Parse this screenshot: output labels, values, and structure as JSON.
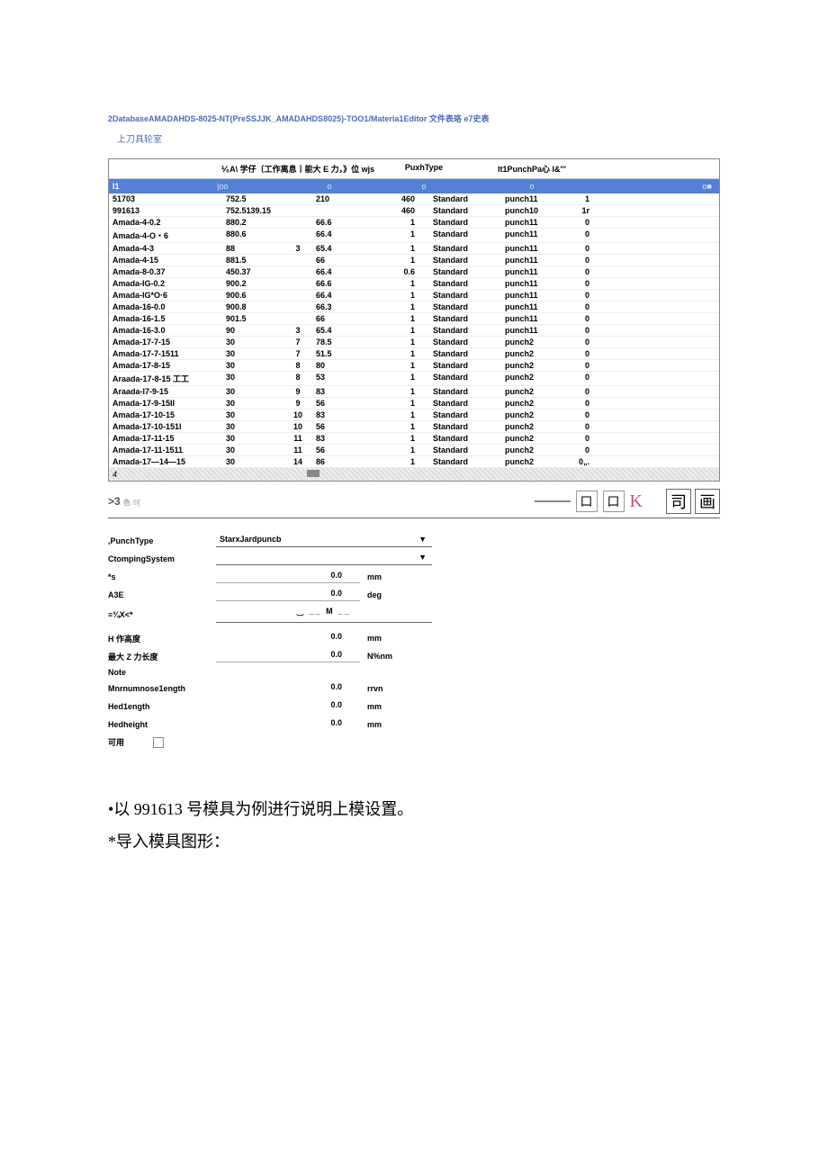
{
  "header": {
    "path": "2DatabaseAMADAHDS-8025-NT(PreSSJJK_AMADAHDS8025)-TOO1/Materia1Editor 文件表珞 e7史表",
    "subtitle": "上刀具轮室"
  },
  "table": {
    "headers": {
      "h1": "",
      "h2": "⅟₆A\\ 学仔〔工作离息丨能大 E 力，》位 wjs",
      "h3": "PuxhType",
      "h4": "It1PunchPa心 I&'''"
    },
    "filter": {
      "a": "I1",
      "b": "|oo",
      "c": "o",
      "d": "o",
      "e": "o",
      "f": "o■"
    },
    "rows": [
      {
        "name": "51703",
        "a": "752.5",
        "b": "",
        "c": "210",
        "d": "460",
        "e": "Standard",
        "f": "punch11",
        "g": "1"
      },
      {
        "name": "991613",
        "a": "752.5139.15",
        "b": "",
        "c": "",
        "d": "460",
        "e": "Standard",
        "f": "punch10",
        "g": "1r"
      },
      {
        "name": "Amada-4-0.2",
        "a": "880.2",
        "b": "",
        "c": "66.6",
        "d": "1",
        "e": "Standard",
        "f": "punch11",
        "g": "0"
      },
      {
        "name": "Amada-4-O・6",
        "a": "880.6",
        "b": "",
        "c": "66.4",
        "d": "1",
        "e": "Standard",
        "f": "punch11",
        "g": "0"
      },
      {
        "name": "Amada-4-3",
        "a": "88",
        "b": "3",
        "c": "65.4",
        "d": "1",
        "e": "Standard",
        "f": "punch11",
        "g": "0"
      },
      {
        "name": "Amada-4-15",
        "a": "881.5",
        "b": "",
        "c": "66",
        "d": "1",
        "e": "Standard",
        "f": "punch11",
        "g": "0"
      },
      {
        "name": "Amada-8-0.37",
        "a": "450.37",
        "b": "",
        "c": "66.4",
        "d": "0.6",
        "e": "Standard",
        "f": "punch11",
        "g": "0"
      },
      {
        "name": "Amada-IG-0.2",
        "a": "900.2",
        "b": "",
        "c": "66.6",
        "d": "1",
        "e": "Standard",
        "f": "punch11",
        "g": "0"
      },
      {
        "name": "Amada-IG*O·6",
        "a": "900.6",
        "b": "",
        "c": "66.4",
        "d": "1",
        "e": "Standard",
        "f": "punch11",
        "g": "0"
      },
      {
        "name": "Amada-16-0.0",
        "a": "900.8",
        "b": "",
        "c": "66.3",
        "d": "1",
        "e": "Standard",
        "f": "punch11",
        "g": "0"
      },
      {
        "name": "Amada-16-1.5",
        "a": "901.5",
        "b": "",
        "c": "66",
        "d": "1",
        "e": "Standard",
        "f": "punch11",
        "g": "0"
      },
      {
        "name": "Amada-16-3.0",
        "a": "90",
        "b": "3",
        "c": "65.4",
        "d": "1",
        "e": "Standard",
        "f": "punch11",
        "g": "0"
      },
      {
        "name": "Amada-17-7-15",
        "a": "30",
        "b": "7",
        "c": "78.5",
        "d": "1",
        "e": "Standard",
        "f": "punch2",
        "g": "0"
      },
      {
        "name": "Amada-17-7-1511",
        "a": "30",
        "b": "7",
        "c": "51.5",
        "d": "1",
        "e": "Standard",
        "f": "punch2",
        "g": "0"
      },
      {
        "name": "Amada-17-8-15",
        "a": "30",
        "b": "8",
        "c": "80",
        "d": "1",
        "e": "Standard",
        "f": "punch2",
        "g": "0"
      },
      {
        "name": "Araada-17-8-15 工工",
        "a": "30",
        "b": "8",
        "c": "53",
        "d": "1",
        "e": "Standard",
        "f": "punch2",
        "g": "0"
      },
      {
        "name": "Araada-I7-9-15",
        "a": "30",
        "b": "9",
        "c": "83",
        "d": "1",
        "e": "Standard",
        "f": "punch2",
        "g": "0"
      },
      {
        "name": "Amada-17-9-15II",
        "a": "30",
        "b": "9",
        "c": "56",
        "d": "1",
        "e": "Standard",
        "f": "punch2",
        "g": "0"
      },
      {
        "name": "Amada-17-10-15",
        "a": "30",
        "b": "10",
        "c": "83",
        "d": "1",
        "e": "Standard",
        "f": "punch2",
        "g": "0"
      },
      {
        "name": "Amada-17-10-151I",
        "a": "30",
        "b": "10",
        "c": "56",
        "d": "1",
        "e": "Standard",
        "f": "punch2",
        "g": "0"
      },
      {
        "name": "Amada-17-11-15",
        "a": "30",
        "b": "11",
        "c": "83",
        "d": "1",
        "e": "Standard",
        "f": "punch2",
        "g": "0"
      },
      {
        "name": "Amada-17-11-1511",
        "a": "30",
        "b": "11",
        "c": "56",
        "d": "1",
        "e": "Standard",
        "f": "punch2",
        "g": "0"
      },
      {
        "name": "Amada-17—14—15",
        "a": "30",
        "b": "14",
        "c": "86",
        "d": "1",
        "e": "Standard",
        "f": "punch2",
        "g": "0„."
      }
    ],
    "footer_num": "4"
  },
  "toolbar": {
    "label_prefix": ">3",
    "label_suffix": "色 ©[",
    "k": "K",
    "r1": "司",
    "r2": "画"
  },
  "form": {
    "punchtype_label": ",PunchType",
    "punchtype_value": "StarxJardpuncb",
    "clamp_label": "CtompingSystem",
    "s_label": "*s",
    "s_value": "0.0",
    "s_unit": "mm",
    "a3e_label": "A3E",
    "a3e_value": "0.0",
    "a3e_unit": "deg",
    "xk_label": "≡¾X<*",
    "xk_img": "‿ __  M  __",
    "h_label": "H 作高度",
    "h_value": "0.0",
    "h_unit": "mm",
    "maxz_label": "最大 Z 力长度",
    "maxz_value": "0.0",
    "maxz_unit": "N%nm",
    "note_label": "Note",
    "min_label": "Mnrnumnose1ength",
    "min_value": "0.0",
    "min_unit": "rrvn",
    "hed_label": "Hed1ength",
    "hed_value": "0.0",
    "hed_unit": "mm",
    "hedh_label": "Hedheight",
    "hedh_value": "0.0",
    "hedh_unit": "mm",
    "avail_label": "可用"
  },
  "prose": {
    "p1": "•以 991613 号模具为例进行说明上模设置。",
    "p2": "*导入模具图形："
  }
}
